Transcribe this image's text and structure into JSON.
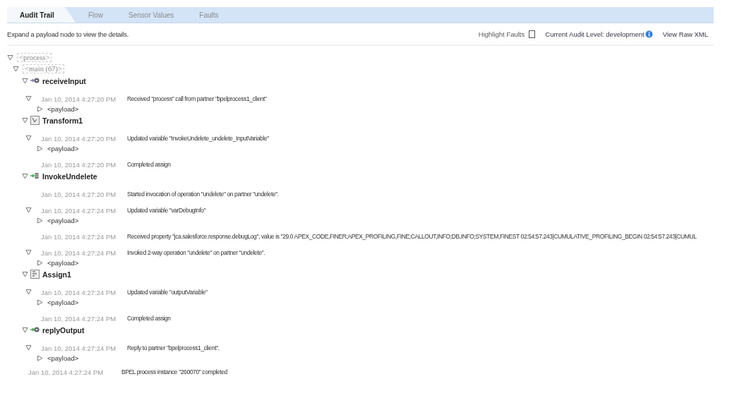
{
  "tabs": [
    {
      "label": "Audit Trail",
      "selected": true
    },
    {
      "label": "Flow",
      "selected": false
    },
    {
      "label": "Sensor Values",
      "selected": false
    },
    {
      "label": "Faults",
      "selected": false
    }
  ],
  "toolbar": {
    "hint": "Expand a payload node to view the details.",
    "highlight_faults": {
      "label": "Highlight Faults",
      "checked": false
    },
    "audit_level": "Current Audit Level: development",
    "view_raw_xml": "View Raw XML"
  },
  "tree": {
    "label": "<process>",
    "expanded": true,
    "children": [
      {
        "label": "<main (67)>",
        "expanded": true,
        "activities": [
          {
            "kind": "receive",
            "name": "receiveInput",
            "expanded": true,
            "events": [
              {
                "expandable": true,
                "time": "Jan 10, 2014 4:27:20 PM",
                "message": "Received \"process\" call from partner \"bpelprocess1_client\"",
                "payload": "<payload>"
              }
            ]
          },
          {
            "kind": "transform",
            "name": "Transform1",
            "expanded": true,
            "events": [
              {
                "expandable": true,
                "time": "Jan 10, 2014 4:27:20 PM",
                "message": "Updated variable \"InvokeUndelete_undelete_InputVariable\"",
                "payload": "<payload>"
              },
              {
                "expandable": false,
                "time": "Jan 10, 2014 4:27:20 PM",
                "message": "Completed assign"
              }
            ]
          },
          {
            "kind": "invoke",
            "name": "InvokeUndelete",
            "expanded": true,
            "events": [
              {
                "expandable": false,
                "time": "Jan 10, 2014 4:27:20 PM",
                "message": "Started invocation of operation \"undelete\" on partner \"undelete\"."
              },
              {
                "expandable": true,
                "time": "Jan 10, 2014 4:27:24 PM",
                "message": "Updated variable \"varDebugInfo\"",
                "payload": "<payload>"
              },
              {
                "expandable": false,
                "time": "Jan 10, 2014 4:27:24 PM",
                "message": "Received property \"jca.salesforce.response.debugLog\", value is \"29.0 APEX_CODE,FINER;APEX_PROFILING,FINE;CALLOUT,INFO;DB,INFO;SYSTEM,FINEST 02:54:57.243|CUMULATIVE_PROFILING_BEGIN 02:54:57.243|CUMUL"
              },
              {
                "expandable": true,
                "time": "Jan 10, 2014 4:27:24 PM",
                "message": "Invoked 2-way operation \"undelete\" on partner \"undelete\".",
                "payload": "<payload>"
              }
            ]
          },
          {
            "kind": "assign",
            "name": "Assign1",
            "expanded": true,
            "events": [
              {
                "expandable": true,
                "time": "Jan 10, 2014 4:27:24 PM",
                "message": "Updated variable \"outputVariable\"",
                "payload": "<payload>"
              },
              {
                "expandable": false,
                "time": "Jan 10, 2014 4:27:24 PM",
                "message": "Completed assign"
              }
            ]
          },
          {
            "kind": "reply",
            "name": "replyOutput",
            "expanded": true,
            "events": [
              {
                "expandable": true,
                "time": "Jan 10, 2014 4:27:24 PM",
                "message": "Reply to partner \"bpelprocess1_client\".",
                "payload": "<payload>"
              }
            ]
          }
        ]
      }
    ]
  },
  "summary": {
    "time": "Jan 10, 2014 4:27:24 PM",
    "message": "BPEL process instance \"260070\" completed"
  }
}
